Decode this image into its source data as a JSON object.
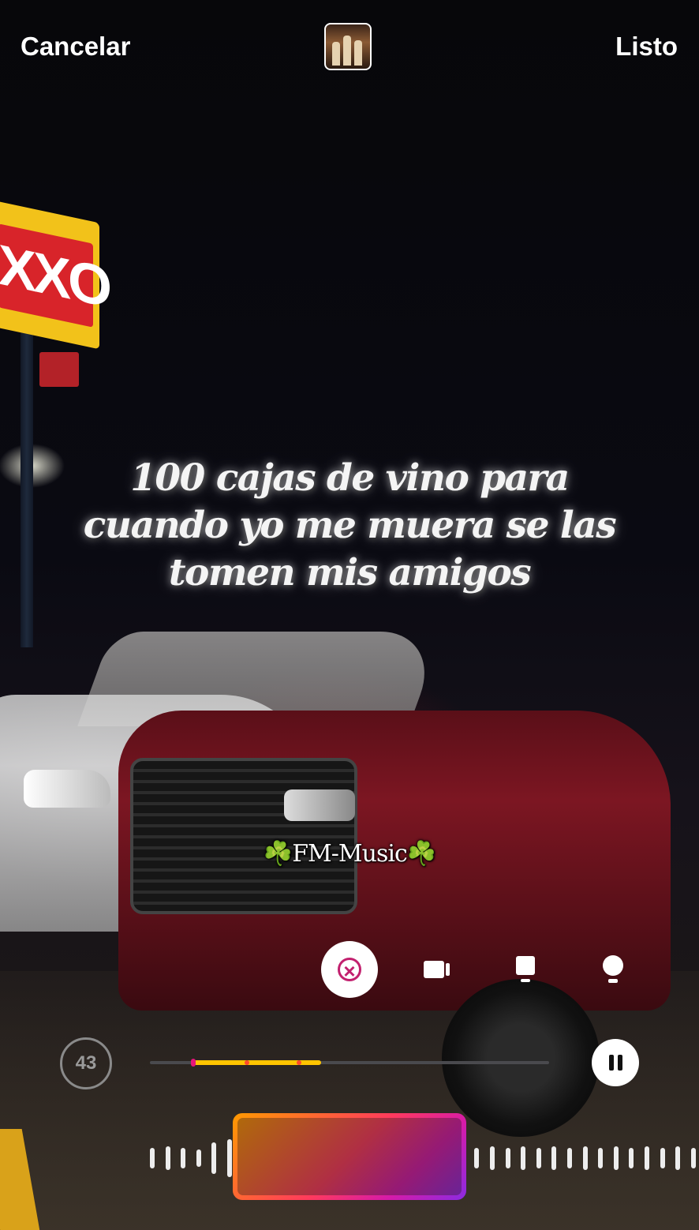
{
  "header": {
    "cancel_label": "Cancelar",
    "done_label": "Listo"
  },
  "lyrics": {
    "lines": [
      "100 cajas de vino para",
      "cuando yo me muera se las",
      "tomen mis amigos"
    ]
  },
  "watermark": {
    "text": "☘️FM-Music☘️"
  },
  "style_buttons": [
    {
      "icon": "remove-lyrics-icon"
    },
    {
      "icon": "video-camera-icon"
    },
    {
      "icon": "card-icon"
    },
    {
      "icon": "bulb-icon"
    }
  ],
  "player": {
    "duration_label": "43",
    "progress_fraction": 0.32,
    "state": "playing",
    "accent_colors": [
      "#ff9a00",
      "#ff3b5c",
      "#d61ba8",
      "#8a2be2"
    ],
    "progress_color": "#ffc400"
  }
}
